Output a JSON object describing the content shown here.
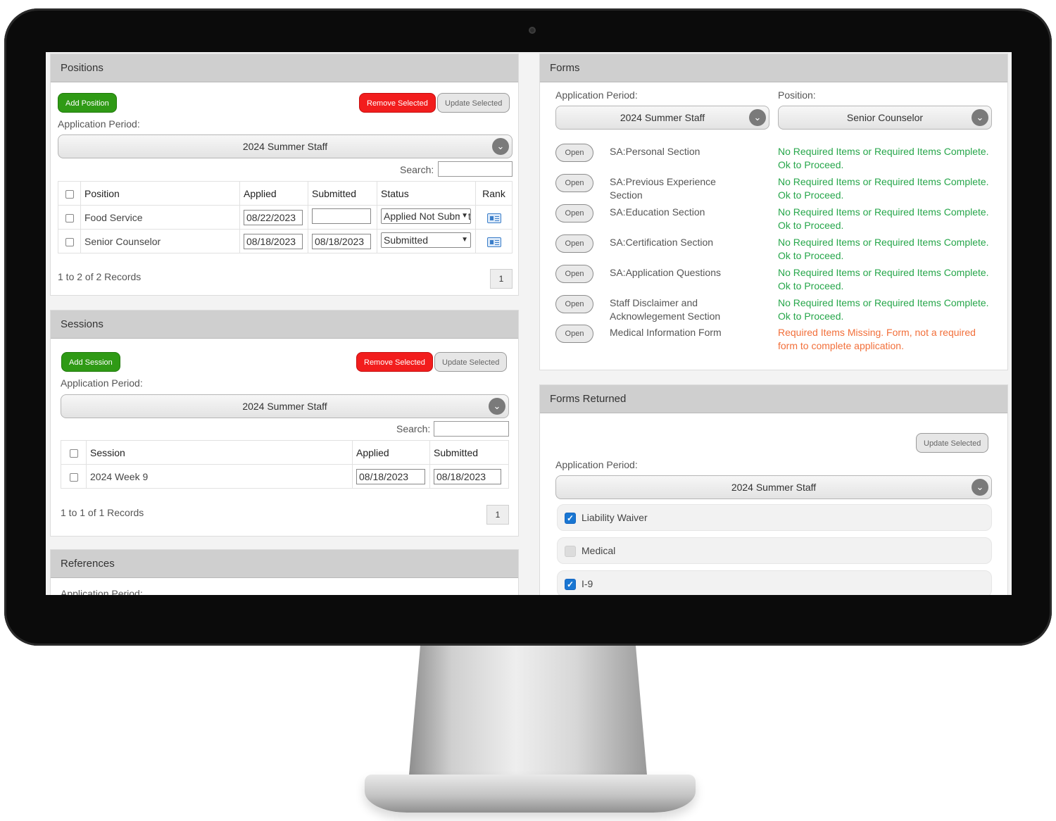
{
  "positions": {
    "title": "Positions",
    "add_button": "Add Position",
    "remove_button": "Remove Selected",
    "update_button": "Update Selected",
    "period_label": "Application Period:",
    "period_value": "2024 Summer Staff",
    "search_label": "Search:",
    "columns": [
      "Position",
      "Applied",
      "Submitted",
      "Status",
      "Rank"
    ],
    "rows": [
      {
        "position": "Food Service",
        "applied": "08/22/2023",
        "submitted": "",
        "status": "Applied Not Submitted"
      },
      {
        "position": "Senior Counselor",
        "applied": "08/18/2023",
        "submitted": "08/18/2023",
        "status": "Submitted"
      }
    ],
    "records": "1 to 2 of 2 Records",
    "page": "1"
  },
  "sessions": {
    "title": "Sessions",
    "add_button": "Add Session",
    "remove_button": "Remove Selected",
    "update_button": "Update Selected",
    "period_label": "Application Period:",
    "period_value": "2024 Summer Staff",
    "search_label": "Search:",
    "columns": [
      "Session",
      "Applied",
      "Submitted"
    ],
    "rows": [
      {
        "session": "2024 Week 9",
        "applied": "08/18/2023",
        "submitted": "08/18/2023"
      }
    ],
    "records": "1 to 1 of 1 Records",
    "page": "1"
  },
  "references": {
    "title": "References",
    "period_label": "Application Period:"
  },
  "forms": {
    "title": "Forms",
    "period_label": "Application Period:",
    "period_value": "2024 Summer Staff",
    "position_label": "Position:",
    "position_value": "Senior Counselor",
    "open_label": "Open",
    "items": [
      {
        "name": "SA:Personal Section",
        "status": "No Required Items or Required Items Complete. Ok to Proceed.",
        "state": "ok"
      },
      {
        "name": "SA:Previous Experience Section",
        "status": "No Required Items or Required Items Complete. Ok to Proceed.",
        "state": "ok"
      },
      {
        "name": "SA:Education Section",
        "status": "No Required Items or Required Items Complete. Ok to Proceed.",
        "state": "ok"
      },
      {
        "name": "SA:Certification Section",
        "status": "No Required Items or Required Items Complete. Ok to Proceed.",
        "state": "ok"
      },
      {
        "name": "SA:Application Questions",
        "status": "No Required Items or Required Items Complete. Ok to Proceed.",
        "state": "ok"
      },
      {
        "name": "Staff Disclaimer and Acknowlegement Section",
        "status": "No Required Items or Required Items Complete. Ok to Proceed.",
        "state": "ok"
      },
      {
        "name": "Medical Information Form",
        "status": "Required Items Missing. Form, not a required form to complete application.",
        "state": "warn"
      }
    ],
    "colors": {
      "ok": "#26a64a",
      "warn": "#f26f3a"
    }
  },
  "forms_returned": {
    "title": "Forms Returned",
    "update_button": "Update Selected",
    "period_label": "Application Period:",
    "period_value": "2024 Summer Staff",
    "items": [
      {
        "label": "Liability Waiver",
        "checked": true
      },
      {
        "label": "Medical",
        "checked": false
      },
      {
        "label": "I-9",
        "checked": true
      }
    ]
  },
  "colors": {
    "green_button": "#2f9a15",
    "red_button": "#f21d1d",
    "panel_header": "#cfcfcf",
    "checkbox_blue": "#1976d2"
  }
}
